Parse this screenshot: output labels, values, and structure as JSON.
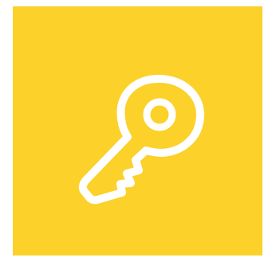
{
  "icon": {
    "name": "key-icon",
    "background_color": "#FBD12A",
    "stroke_color": "#FFFFFF"
  }
}
